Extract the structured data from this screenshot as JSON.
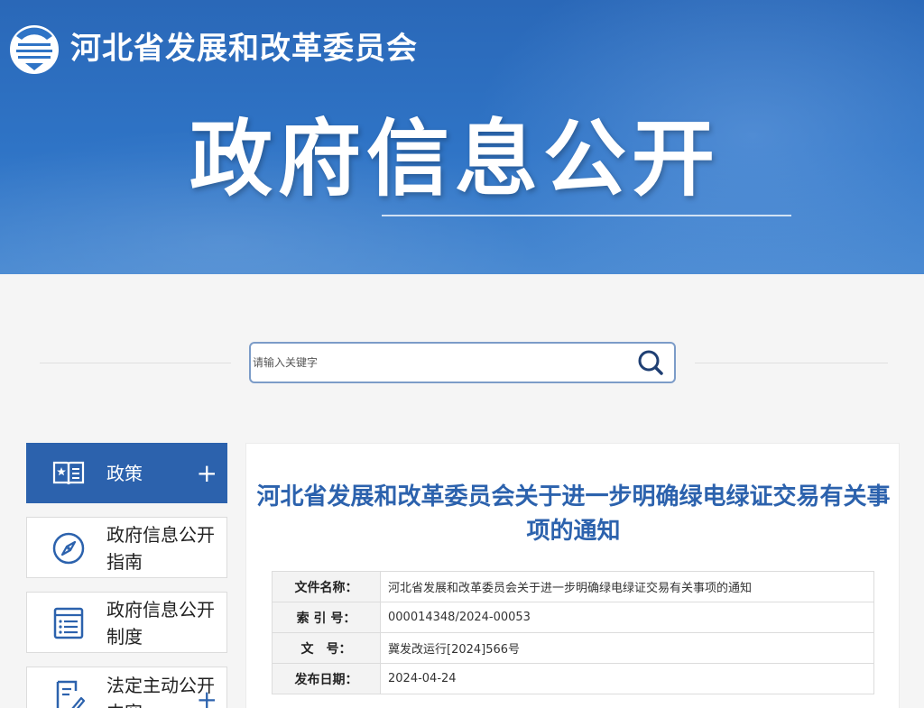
{
  "header": {
    "org_name": "河北省发展和改革委员会",
    "section_title": "政府信息公开",
    "logo_icon": "hebei-ndrc-logo"
  },
  "search": {
    "placeholder": "请输入关键字",
    "value": "",
    "button_icon": "search-icon"
  },
  "sidebar": {
    "items": [
      {
        "label": "政策",
        "icon": "policy-book-icon",
        "expandable": true,
        "active": true
      },
      {
        "label": "政府信息公开指南",
        "icon": "compass-icon",
        "expandable": false,
        "active": false
      },
      {
        "label": "政府信息公开制度",
        "icon": "list-document-icon",
        "expandable": false,
        "active": false
      },
      {
        "label": "法定主动公开内容",
        "icon": "edit-document-icon",
        "expandable": true,
        "active": false
      }
    ],
    "plus_symbol": "+"
  },
  "document": {
    "title": "河北省发展和改革委员会关于进一步明确绿电绿证交易有关事项的通知",
    "meta": [
      {
        "key": "文件名称：",
        "value": "河北省发展和改革委员会关于进一步明确绿电绿证交易有关事项的通知"
      },
      {
        "key": "索 引 号：",
        "value": "000014348/2024-00053"
      },
      {
        "key": "文　号：",
        "value": "冀发改运行[2024]566号"
      },
      {
        "key": "发布日期：",
        "value": "2024-04-24"
      }
    ]
  },
  "colors": {
    "brand_blue": "#2c62ad",
    "banner_blue": "#2f74c6",
    "search_border": "#7c9cc8"
  }
}
